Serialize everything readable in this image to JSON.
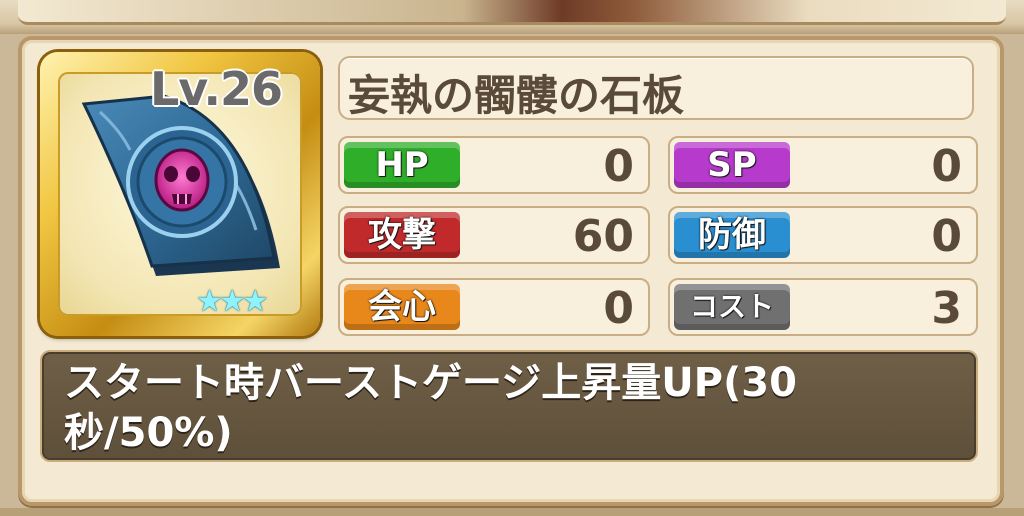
{
  "item": {
    "level": "Lv.26",
    "name": "妄執の髑髏の石板",
    "rarity_stars": "★★★",
    "icon": "skull-stone-slab-icon"
  },
  "stats": {
    "hp": {
      "label": "HP",
      "value": "0",
      "color": "#2fae2a"
    },
    "sp": {
      "label": "SP",
      "value": "0",
      "color": "#b63acb"
    },
    "attack": {
      "label": "攻撃",
      "value": "60",
      "color": "#c02a2a"
    },
    "defense": {
      "label": "防御",
      "value": "0",
      "color": "#2a8fd0"
    },
    "critical": {
      "label": "会心",
      "value": "0",
      "color": "#e8871a"
    },
    "cost": {
      "label": "コスト",
      "value": "3",
      "color": "#707070"
    }
  },
  "effect": {
    "text": "スタート時バーストゲージ上昇量UP(30秒/50%)"
  }
}
